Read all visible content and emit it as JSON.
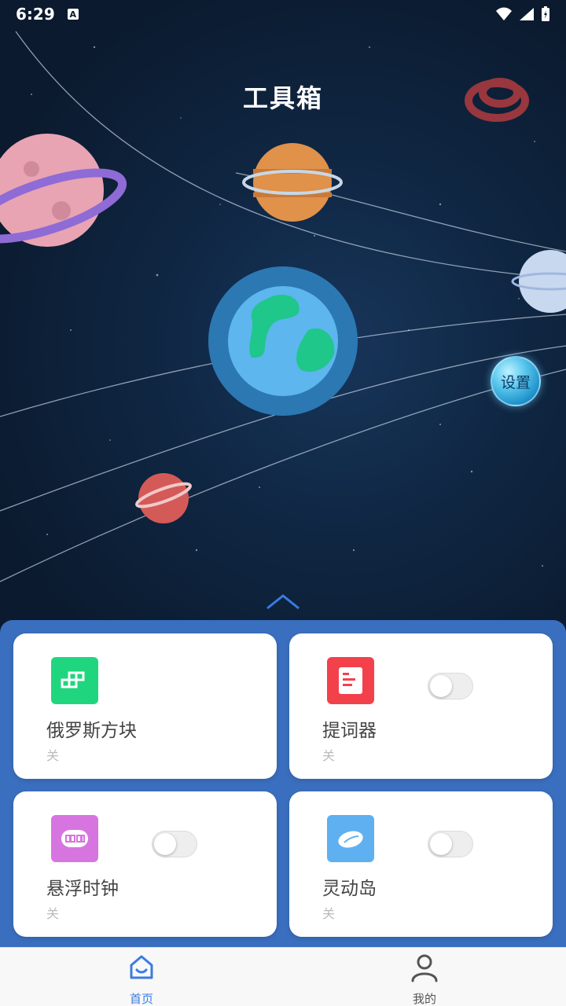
{
  "status_bar": {
    "time": "6:29",
    "notification_badge": "A"
  },
  "header": {
    "title": "工具箱"
  },
  "settings_button": {
    "label": "设置"
  },
  "tools": [
    {
      "name": "俄罗斯方块",
      "status": "关",
      "icon": "tetris-icon",
      "color": "#1fd67f"
    },
    {
      "name": "提词器",
      "status": "关",
      "icon": "teleprompter-icon",
      "color": "#f2414b"
    },
    {
      "name": "悬浮时钟",
      "status": "关",
      "icon": "clock-icon",
      "color": "#d775e0"
    },
    {
      "name": "灵动岛",
      "status": "关",
      "icon": "island-icon",
      "color": "#5eb0f0"
    }
  ],
  "bottom_nav": [
    {
      "label": "首页",
      "icon": "home-icon",
      "active": true
    },
    {
      "label": "我的",
      "icon": "profile-icon",
      "active": false
    }
  ],
  "colors": {
    "accent": "#3a6fbf",
    "nav_active": "#3a7be0",
    "nav_inactive": "#555555"
  }
}
